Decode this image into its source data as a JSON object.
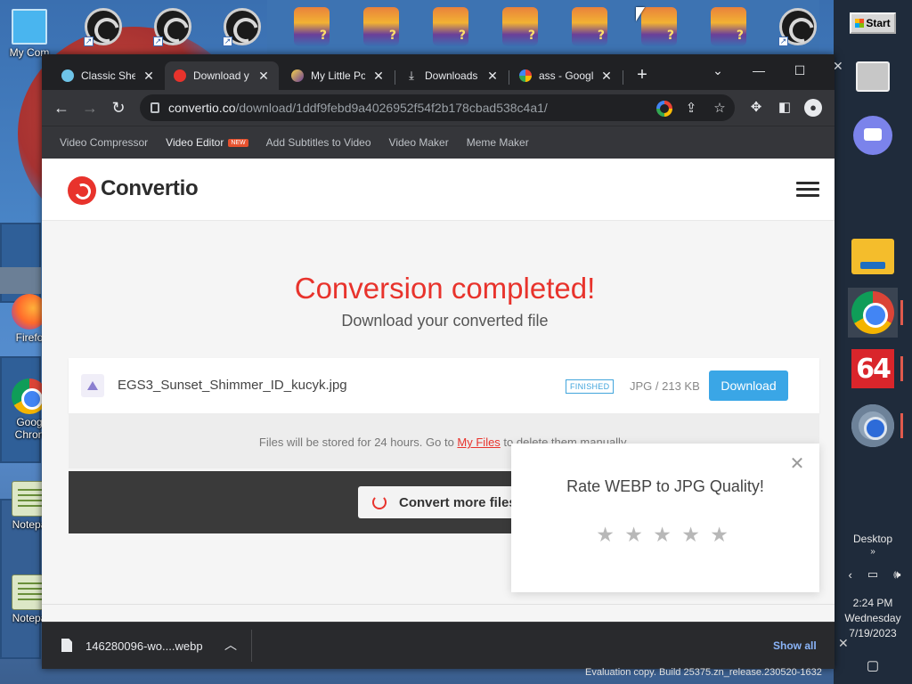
{
  "desktop": {
    "top_icons": [
      {
        "kind": "obs",
        "shortcut": true
      },
      {
        "kind": "obs",
        "shortcut": true
      },
      {
        "kind": "obs",
        "shortcut": true
      },
      {
        "kind": "pony",
        "shortcut": false
      },
      {
        "kind": "pony",
        "shortcut": false
      },
      {
        "kind": "pony",
        "shortcut": false
      },
      {
        "kind": "pony",
        "shortcut": false
      },
      {
        "kind": "pony",
        "shortcut": false
      },
      {
        "kind": "pony",
        "shortcut": false
      },
      {
        "kind": "pony",
        "shortcut": false
      },
      {
        "kind": "obs",
        "shortcut": true
      }
    ],
    "left_icons": [
      {
        "label": "My Com",
        "icon": "monitor-icon"
      },
      {
        "label": "Firefo",
        "icon": "firefox-icon"
      },
      {
        "label": "Goog Chron",
        "icon": "chrome-icon"
      },
      {
        "label": "Notepa",
        "icon": "notepad-icon"
      },
      {
        "label": "Notepa",
        "icon": "notepad-icon"
      }
    ]
  },
  "taskbar": {
    "start_label": "Start",
    "desktop_label": "Desktop",
    "time": "2:24 PM",
    "day": "Wednesday",
    "date": "7/19/2023",
    "c64_label": "64"
  },
  "browser": {
    "tabs": [
      {
        "title": "Classic Shell",
        "favicon": "classic-shell-icon",
        "active": false
      },
      {
        "title": "Download y",
        "favicon": "convertio-icon",
        "active": true
      },
      {
        "title": "My Little Po",
        "favicon": "pony-icon",
        "active": false
      },
      {
        "title": "Downloads",
        "favicon": "download-icon",
        "active": false
      },
      {
        "title": "ass - Googl",
        "favicon": "google-icon",
        "active": false
      }
    ],
    "url_host": "convertio.co",
    "url_path": "/download/1ddf9febd9a4026952f54f2b178cbad538c4a1/",
    "bookmarks": [
      {
        "label": "Video Compressor",
        "badge": ""
      },
      {
        "label": "Video Editor",
        "badge": "NEW"
      },
      {
        "label": "Add Subtitles to Video",
        "badge": ""
      },
      {
        "label": "Video Maker",
        "badge": ""
      },
      {
        "label": "Meme Maker",
        "badge": ""
      }
    ]
  },
  "page": {
    "logo_text": "Convertio",
    "title": "Conversion completed!",
    "subtitle": "Download your converted file",
    "file": {
      "name": "EGS3_Sunset_Shimmer_ID_kucyk.jpg",
      "status": "FINISHED",
      "size": "JPG / 213 KB",
      "download_label": "Download"
    },
    "store_note_before": "Files will be stored for 24 hours. Go to ",
    "store_note_link": "My Files",
    "store_note_after": " to delete them manually.",
    "convert_more_label": "Convert more files",
    "rating": {
      "title": "Rate WEBP to JPG Quality!",
      "stars": 5,
      "star_glyph": "★"
    }
  },
  "download_bar": {
    "file_name": "146280096-wo....webp",
    "show_all": "Show all"
  },
  "watermark": "Evaluation copy. Build 25375.zn_release.230520-1632",
  "colors": {
    "brand_red": "#e8332c",
    "download_blue": "#3aa6e6",
    "chrome_dark": "#202124",
    "chrome_toolbar": "#35363a"
  }
}
